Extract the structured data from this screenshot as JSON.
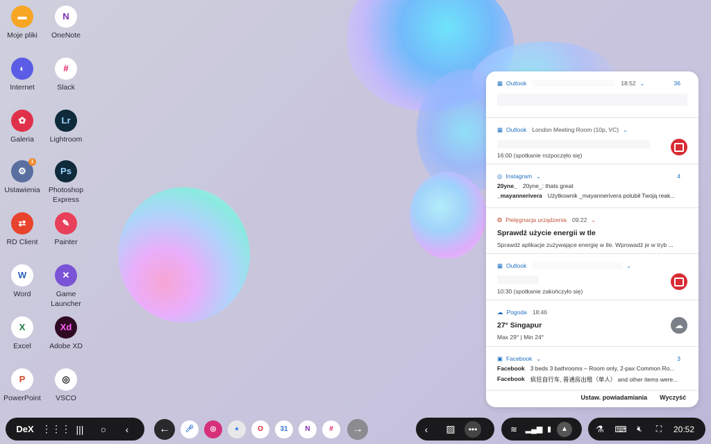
{
  "desktop": {
    "icons_col1": [
      {
        "label": "Moje pliki",
        "icon": "folder-icon",
        "color": "#f6a623",
        "glyph": "▬"
      },
      {
        "label": "Internet",
        "icon": "internet-icon",
        "color": "#5b5de6",
        "glyph": "◐"
      },
      {
        "label": "Galeria",
        "icon": "gallery-icon",
        "color": "#e0314a",
        "glyph": "✿"
      },
      {
        "label": "Ustawienia",
        "icon": "settings-icon",
        "color": "#5a6fa0",
        "glyph": "⚙",
        "badge": "1"
      },
      {
        "label": "RD Client",
        "icon": "rdclient-icon",
        "color": "#e8432c",
        "glyph": "⇄"
      },
      {
        "label": "Word",
        "icon": "word-icon",
        "color": "#ffffff",
        "glyph": "W",
        "fg": "#2b5fbd"
      },
      {
        "label": "Excel",
        "icon": "excel-icon",
        "color": "#ffffff",
        "glyph": "X",
        "fg": "#1e7a45"
      },
      {
        "label": "PowerPoint",
        "icon": "powerpoint-icon",
        "color": "#ffffff",
        "glyph": "P",
        "fg": "#d24726"
      }
    ],
    "icons_col2": [
      {
        "label": "OneNote",
        "icon": "onenote-icon",
        "color": "#ffffff",
        "glyph": "N",
        "fg": "#7b2fb5"
      },
      {
        "label": "Slack",
        "icon": "slack-icon",
        "color": "#ffffff",
        "glyph": "#",
        "fg": "#e01e5a"
      },
      {
        "label": "Lightroom",
        "icon": "lightroom-icon",
        "color": "#0f2a3a",
        "glyph": "Lr",
        "fg": "#9fd4ff"
      },
      {
        "label": "Photoshop Express",
        "icon": "photoshop-express-icon",
        "color": "#0f2a3a",
        "glyph": "Ps",
        "fg": "#9fd4ff"
      },
      {
        "label": "Painter",
        "icon": "painter-icon",
        "color": "#e8405a",
        "glyph": "✎"
      },
      {
        "label": "Game Launcher",
        "icon": "game-launcher-icon",
        "color": "#7a53d6",
        "glyph": "✕"
      },
      {
        "label": "Adobe XD",
        "icon": "adobe-xd-icon",
        "color": "#2e0b23",
        "glyph": "Xd",
        "fg": "#ff61f6"
      },
      {
        "label": "VSCO",
        "icon": "vsco-icon",
        "color": "#ffffff",
        "glyph": "◎",
        "fg": "#222222"
      }
    ]
  },
  "notifications": {
    "outlook1": {
      "app": "Outlook",
      "time": "18:52",
      "count": "36"
    },
    "outlook2": {
      "app": "Outlook",
      "subject": "London Meeting Room (10p, VC)",
      "body": "16:00 (spotkanie rozpoczęło się)"
    },
    "instagram": {
      "app": "Instagram",
      "count": "4",
      "rows": [
        {
          "sender": "20yne_",
          "text": "20yne_: thats great"
        },
        {
          "sender": "_mayannerivera",
          "text": "Użytkownik _mayannerivera polubił Twoją reak..."
        }
      ]
    },
    "care": {
      "app": "Pielęgnacja urządzenia",
      "time": "09:22",
      "title": "Sprawdź użycie energii w tle",
      "body": "Sprawdź aplikacje zużywające energię w tle. Wprowadź je w tryb ..."
    },
    "outlook3": {
      "app": "Outlook",
      "body": "10:30 (spotkanie zakończyło się)"
    },
    "weather": {
      "app": "Pogoda",
      "time": "18:46",
      "title": "27° Singapur",
      "body": "Max 29° | Min 24°"
    },
    "facebook": {
      "app": "Facebook",
      "count": "3",
      "rows": [
        {
          "sender": "Facebook",
          "text": "3 beds 3 bathrooms – Room only, 2-pax Common Ro..."
        },
        {
          "sender": "Facebook",
          "text": "疯狂自行车, 普通房出租（单人） and other items were..."
        }
      ]
    },
    "footer": {
      "settings": "Ustaw. powiadamiania",
      "clear": "Wyczyść"
    }
  },
  "taskbar": {
    "dex_label": "DeX",
    "clock": "20:52",
    "dock_apps": [
      {
        "name": "instagram-icon",
        "color": "#d6307a",
        "glyph": "◎"
      },
      {
        "name": "chrome-icon",
        "color": "#e8e8e8",
        "glyph": "●",
        "fg": "#4285f4"
      },
      {
        "name": "opera-icon",
        "color": "#ffffff",
        "glyph": "O",
        "fg": "#e0202a"
      },
      {
        "name": "calendar-icon",
        "color": "#ffffff",
        "glyph": "31",
        "fg": "#3a78d8"
      },
      {
        "name": "onenote-dock-icon",
        "color": "#ffffff",
        "glyph": "N",
        "fg": "#7b2fb5"
      },
      {
        "name": "slack-dock-icon",
        "color": "#ffffff",
        "glyph": "#",
        "fg": "#e01e5a"
      }
    ]
  }
}
